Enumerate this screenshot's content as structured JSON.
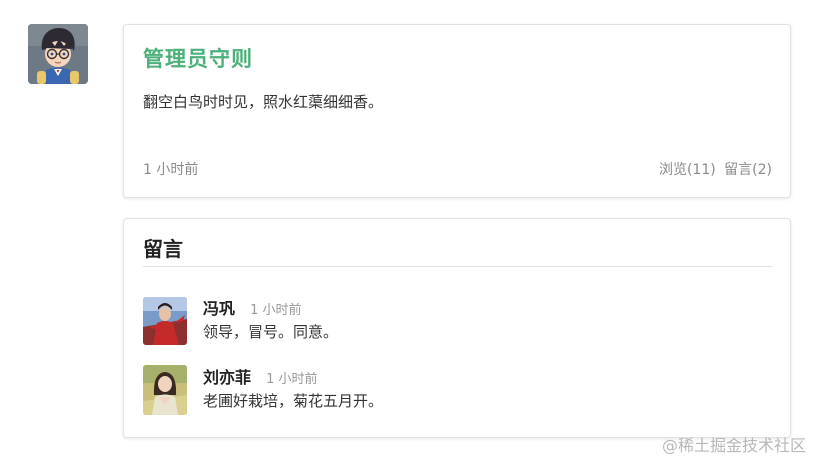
{
  "post": {
    "title": "管理员守则",
    "body": "翻空白鸟时时见，照水红蕖细细香。",
    "time": "1 小时前",
    "views_label": "浏览(11)",
    "comments_label": "留言(2)"
  },
  "comments_section": {
    "heading": "留言",
    "items": [
      {
        "name": "冯巩",
        "time": "1 小时前",
        "text": "领导，冒号。同意。"
      },
      {
        "name": "刘亦菲",
        "time": "1 小时前",
        "text": "老圃好栽培，菊花五月开。"
      }
    ]
  },
  "watermark": "@稀土掘金技术社区",
  "colors": {
    "title_green": "#4cb07a",
    "muted_text": "#8a8a8a",
    "card_border": "#e3e3e3"
  }
}
